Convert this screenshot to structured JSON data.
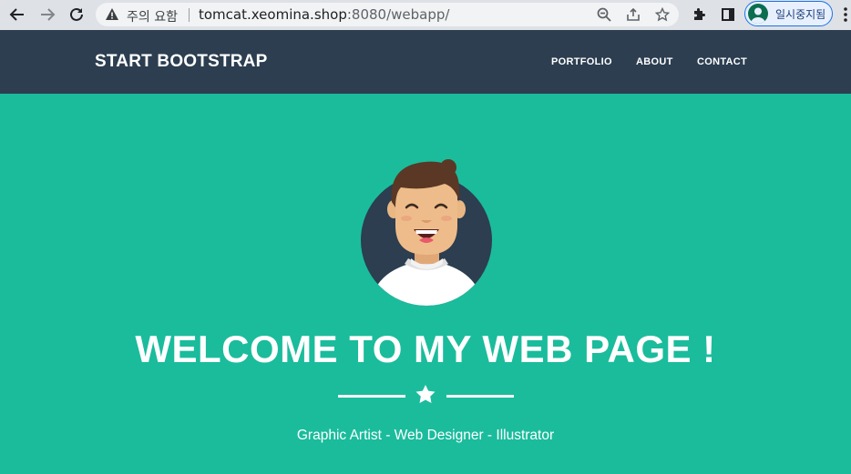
{
  "browser": {
    "back_icon": "arrow-left-icon",
    "forward_icon": "arrow-right-icon",
    "reload_icon": "reload-icon",
    "security_warning": "주의 요함",
    "url_host": "tomcat.xeomina.shop",
    "url_rest": ":8080/webapp/",
    "profile_label": "일시중지됨"
  },
  "navbar": {
    "brand": "START BOOTSTRAP",
    "links": [
      "PORTFOLIO",
      "ABOUT",
      "CONTACT"
    ]
  },
  "masthead": {
    "heading": "WELCOME TO MY WEB PAGE !",
    "subheading": "Graphic Artist - Web Designer - Illustrator"
  },
  "colors": {
    "navbar_bg": "#2c3e50",
    "hero_bg": "#1abc9c",
    "text": "#ffffff"
  }
}
